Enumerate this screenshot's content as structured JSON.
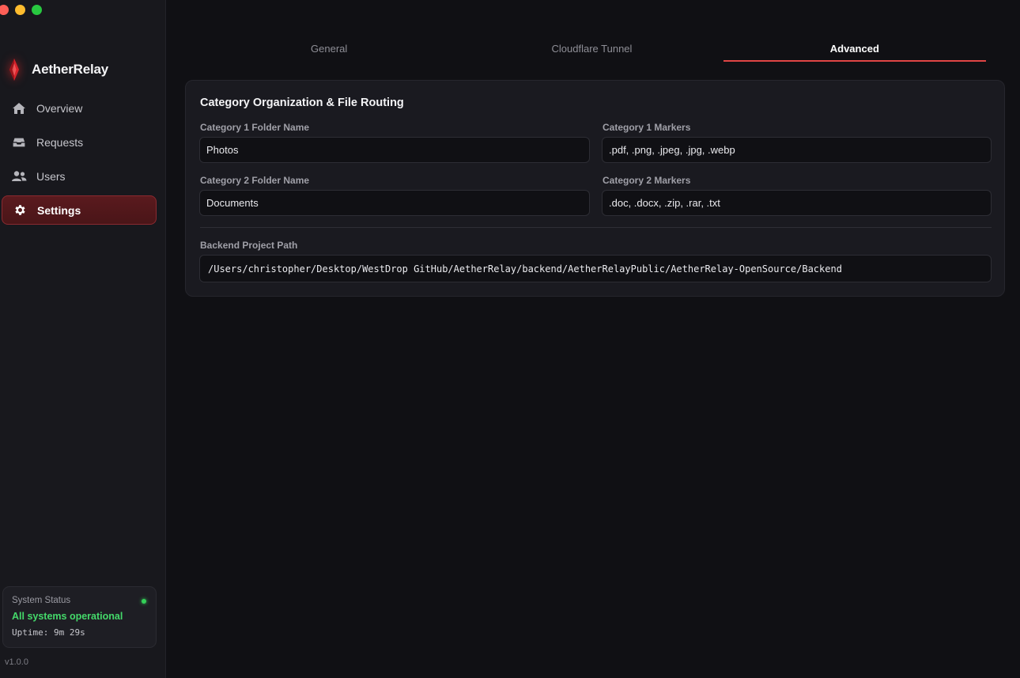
{
  "app": {
    "name": "AetherRelay",
    "version": "v1.0.0",
    "accent": "#e04545"
  },
  "sidebar": {
    "items": [
      {
        "label": "Overview",
        "icon": "home-icon"
      },
      {
        "label": "Requests",
        "icon": "inbox-icon"
      },
      {
        "label": "Users",
        "icon": "users-icon"
      },
      {
        "label": "Settings",
        "icon": "gear-icon",
        "active": true
      }
    ]
  },
  "status": {
    "title": "System Status",
    "text": "All systems operational",
    "uptime": "Uptime: 9m 29s",
    "color": "#44d96a"
  },
  "tabs": [
    {
      "label": "General"
    },
    {
      "label": "Cloudflare Tunnel"
    },
    {
      "label": "Advanced",
      "active": true
    }
  ],
  "section": {
    "title": "Category Organization & File Routing",
    "cat1_folder_label": "Category 1 Folder Name",
    "cat1_folder_value": "Photos",
    "cat1_markers_label": "Category 1 Markers",
    "cat1_markers_value": ".pdf, .png, .jpeg, .jpg, .webp",
    "cat2_folder_label": "Category 2 Folder Name",
    "cat2_folder_value": "Documents",
    "cat2_markers_label": "Category 2 Markers",
    "cat2_markers_value": ".doc, .docx, .zip, .rar, .txt",
    "backend_path_label": "Backend Project Path",
    "backend_path_value": "/Users/christopher/Desktop/WestDrop GitHub/AetherRelay/backend/AetherRelayPublic/AetherRelay-OpenSource/Backend"
  }
}
